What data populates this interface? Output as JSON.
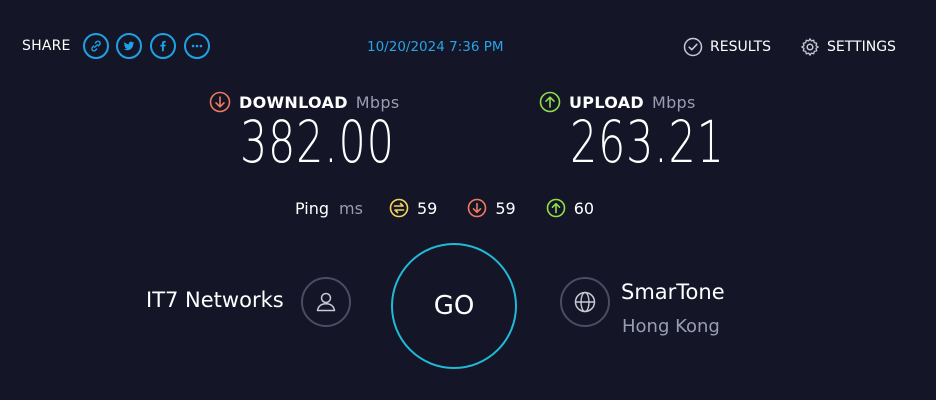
{
  "header": {
    "share_label": "SHARE",
    "share_buttons": [
      {
        "icon": "link-icon"
      },
      {
        "icon": "twitter-icon"
      },
      {
        "icon": "facebook-icon"
      },
      {
        "icon": "more-icon"
      }
    ],
    "timestamp": "10/20/2024 7:36 PM",
    "results_label": "RESULTS",
    "settings_label": "SETTINGS"
  },
  "download": {
    "label": "DOWNLOAD",
    "unit": "Mbps",
    "value": "382.00",
    "color": "#f07a5e"
  },
  "upload": {
    "label": "UPLOAD",
    "unit": "Mbps",
    "value": "263.21",
    "color": "#8fe04a"
  },
  "ping": {
    "label": "Ping",
    "unit": "ms",
    "idle": "59",
    "download": "59",
    "upload": "60",
    "idle_color": "#f4d65a"
  },
  "provider": {
    "name": "IT7 Networks"
  },
  "go_label": "GO",
  "server": {
    "name": "SmarTone",
    "location": "Hong Kong"
  },
  "colors": {
    "accent": "#1fa1e6",
    "go_ring": "#22b9d7",
    "background": "#141526"
  }
}
